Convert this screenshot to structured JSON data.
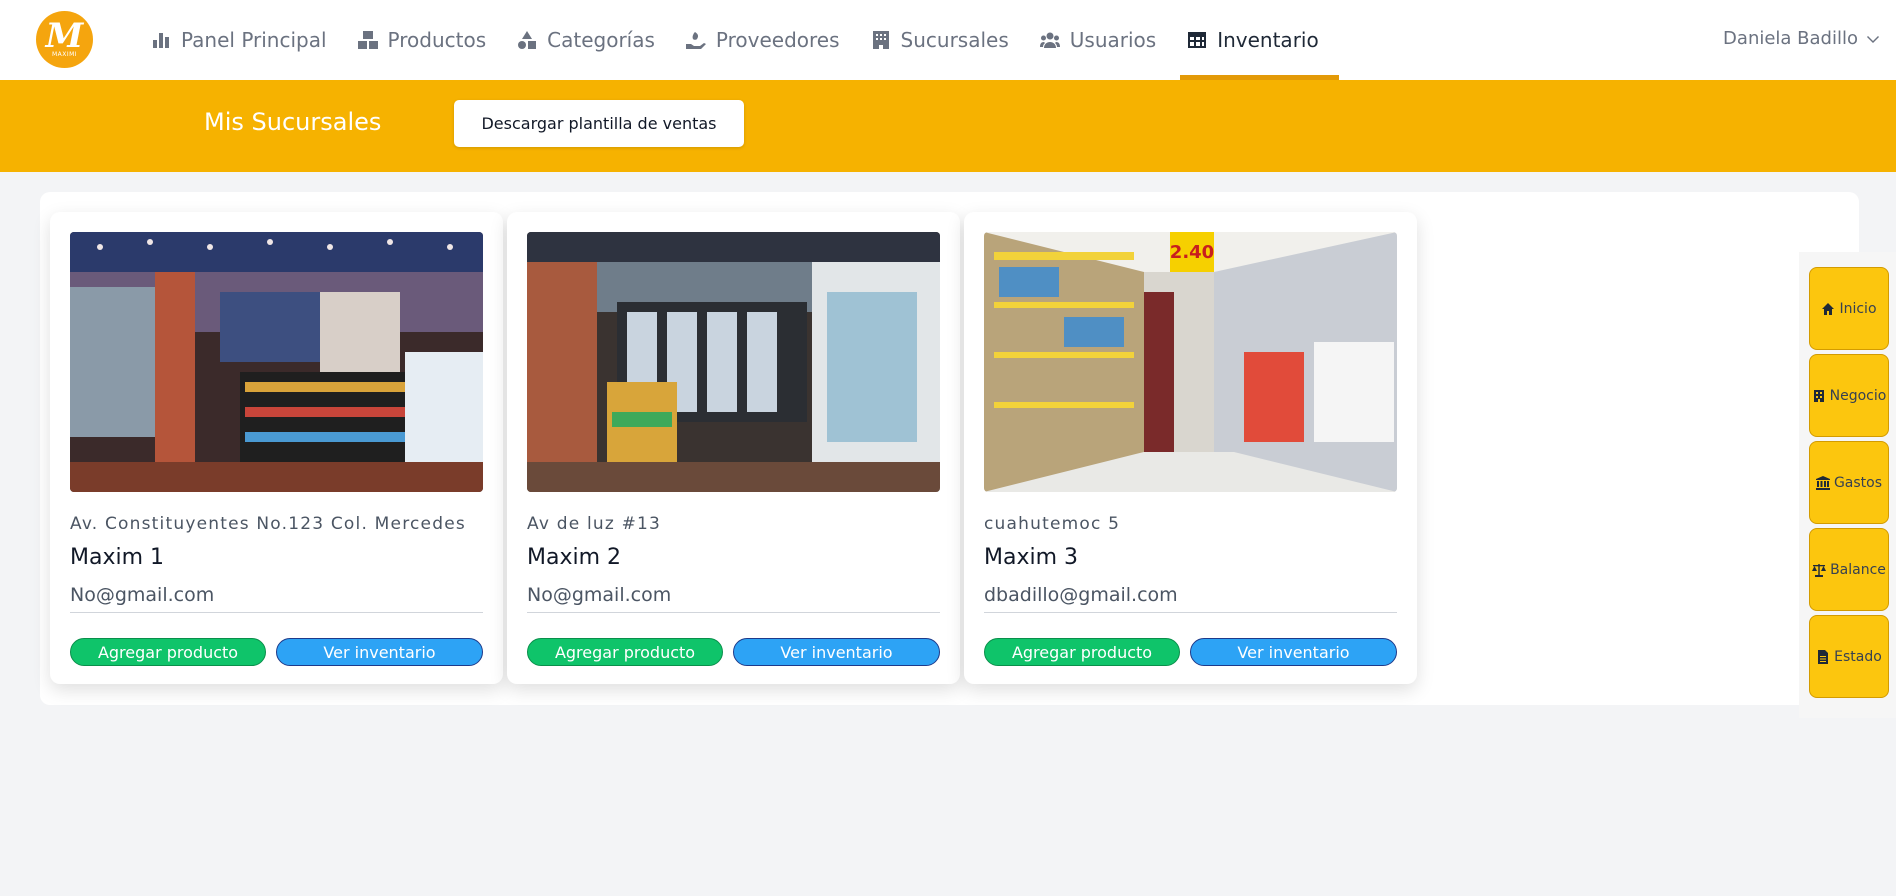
{
  "brand": {
    "logo_letter": "M",
    "logo_subtext": "MAXIMI"
  },
  "nav": {
    "items": [
      {
        "label": "Panel Principal",
        "icon": "bar-chart-icon"
      },
      {
        "label": "Productos",
        "icon": "boxes-icon"
      },
      {
        "label": "Categorías",
        "icon": "shapes-icon"
      },
      {
        "label": "Proveedores",
        "icon": "hand-holding-icon"
      },
      {
        "label": "Sucursales",
        "icon": "building-icon"
      },
      {
        "label": "Usuarios",
        "icon": "users-icon"
      },
      {
        "label": "Inventario",
        "icon": "table-icon",
        "active": true
      }
    ],
    "user_name": "Daniela Badillo"
  },
  "header": {
    "title": "Mis Sucursales",
    "download_button": "Descargar plantilla de ventas"
  },
  "branches": [
    {
      "address": "Av. Constituyentes No.123 Col. Mercedes",
      "name": "Maxim 1",
      "email": "No@gmail.com",
      "add_label": "Agregar producto",
      "inventory_label": "Ver inventario"
    },
    {
      "address": "Av de luz #13",
      "name": "Maxim 2",
      "email": "No@gmail.com",
      "add_label": "Agregar producto",
      "inventory_label": "Ver inventario"
    },
    {
      "address": "cuahutemoc 5",
      "name": "Maxim 3",
      "email": "dbadillo@gmail.com",
      "add_label": "Agregar producto",
      "inventory_label": "Ver inventario",
      "price_sign": "2.40"
    }
  ],
  "side_menu": [
    {
      "label": "Inicio",
      "icon": "home-icon"
    },
    {
      "label": "Negocio",
      "icon": "store-icon"
    },
    {
      "label": "Gastos",
      "icon": "bank-icon"
    },
    {
      "label": "Balance",
      "icon": "scale-icon"
    },
    {
      "label": "Estado",
      "icon": "document-icon"
    }
  ],
  "colors": {
    "accent": "#f6b200",
    "active_underline": "#e39a07",
    "add_button": "#0fc46a",
    "inventory_button": "#2da3f5",
    "side_button": "#fcc60e"
  }
}
